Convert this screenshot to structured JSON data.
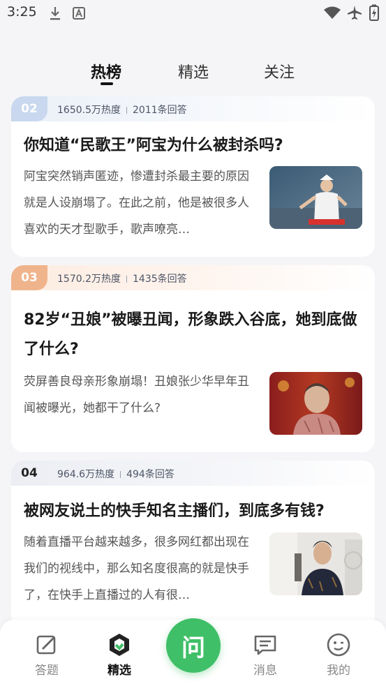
{
  "status_bar": {
    "time": "3:25",
    "icons": [
      "download-icon",
      "a-letter-icon",
      "wifi-icon",
      "airplane-icon",
      "battery-charging-icon"
    ]
  },
  "top_tabs": [
    {
      "label": "热榜",
      "active": true
    },
    {
      "label": "精选",
      "active": false
    },
    {
      "label": "关注",
      "active": false
    }
  ],
  "cards": [
    {
      "rank": "02",
      "heat": "1650.5万热度",
      "answers": "2011条回答",
      "title": "你知道“民歌王”阿宝为什么被封杀吗?",
      "excerpt": "阿宝突然销声匿迹，惨遭封杀最主要的原因就是人设崩塌了。在此之前，他是被很多人喜欢的天才型歌手，歌声嘹亮…"
    },
    {
      "rank": "03",
      "heat": "1570.2万热度",
      "answers": "1435条回答",
      "title": "82岁“丑娘”被曝丑闻，形象跌入谷底，她到底做了什么?",
      "excerpt": "荧屏善良母亲形象崩塌！丑娘张少华早年丑闻被曝光，她都干了什么?"
    },
    {
      "rank": "04",
      "heat": "964.6万热度",
      "answers": "494条回答",
      "title": "被网友说土的快手知名主播们，到底多有钱?",
      "excerpt": "随着直播平台越来越多，很多网红都出现在我们的视线中，那么知名度很高的就是快手了，在快手上直播过的人有很…"
    }
  ],
  "bottom_nav": {
    "items": [
      {
        "label": "答题",
        "icon": "edit-icon"
      },
      {
        "label": "精选",
        "icon": "featured-icon",
        "active": true
      },
      {
        "label": "消息",
        "icon": "message-icon"
      },
      {
        "label": "我的",
        "icon": "profile-icon"
      }
    ],
    "ask_label": "问"
  },
  "colors": {
    "accent_green": "#3fbf67",
    "rank2_badge": "#c9d8ee",
    "rank3_badge": "#f0b48c"
  }
}
